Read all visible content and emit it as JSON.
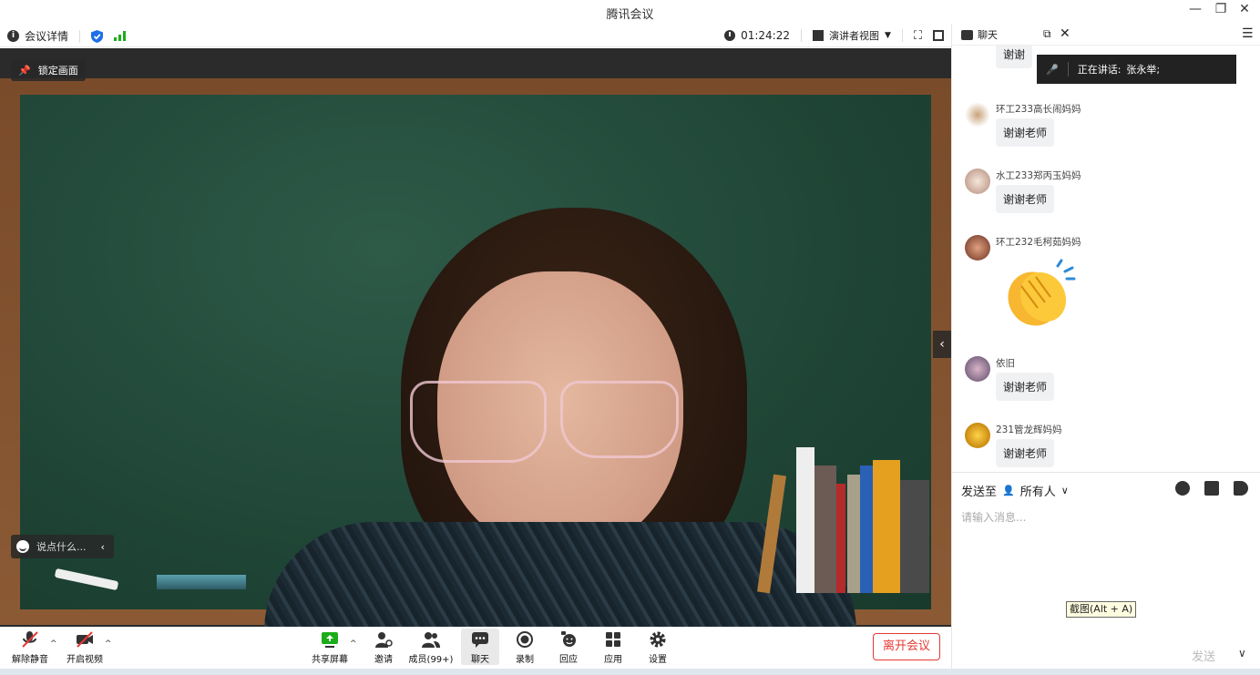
{
  "window": {
    "title": "腾讯会议"
  },
  "infobar": {
    "meeting_details": "会议详情",
    "timer": "01:24:22",
    "view_mode": "演讲者视图"
  },
  "video": {
    "lock_label": "锁定画面",
    "say_placeholder": "说点什么..."
  },
  "toolbar": {
    "unmute": "解除静音",
    "start_video": "开启视频",
    "share_screen": "共享屏幕",
    "invite": "邀请",
    "members": "成员(99+)",
    "chat": "聊天",
    "record": "录制",
    "react": "回应",
    "apps": "应用",
    "settings": "设置",
    "leave": "离开会议"
  },
  "chat": {
    "tab_label": "聊天",
    "speaking_label": "正在讲话:",
    "speaking_name": "张永举;",
    "messages": [
      {
        "sender": "",
        "text": "谢谢"
      },
      {
        "sender": "环工233高长闹妈妈",
        "text": "谢谢老师"
      },
      {
        "sender": "水工233郑丙玉妈妈",
        "text": "谢谢老师"
      },
      {
        "sender": "环工232毛柯茹妈妈",
        "text": "",
        "emoji": "clapping-hands"
      },
      {
        "sender": "依旧",
        "text": "谢谢老师"
      },
      {
        "sender": "231管龙辉妈妈",
        "text": "谢谢老师"
      }
    ],
    "send_to_label": "发送至",
    "recipient": "所有人",
    "input_placeholder": "请输入消息...",
    "screenshot_tooltip": "截图(Alt + A)",
    "send_label": "发送"
  },
  "colors": {
    "accent_red": "#e53935",
    "signal_green": "#1aad19",
    "shield_blue": "#1e6fe8"
  }
}
